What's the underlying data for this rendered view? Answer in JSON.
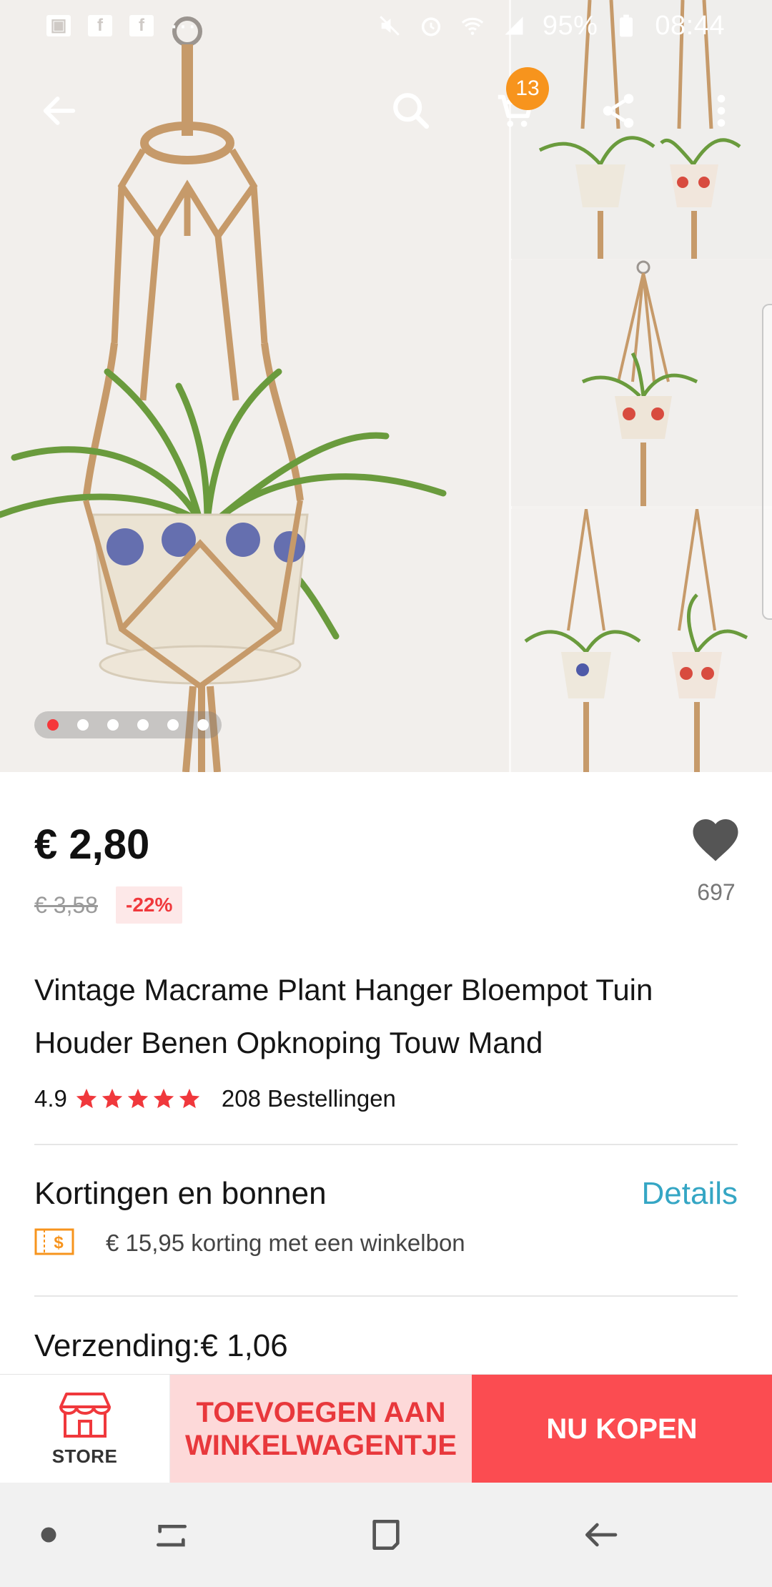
{
  "status_bar": {
    "battery": "95%",
    "time": "08:44"
  },
  "top_bar": {
    "cart_count": "13"
  },
  "gallery": {
    "image_count": 6,
    "active_index": 0
  },
  "product": {
    "price": "€ 2,80",
    "old_price": "€ 3,58",
    "discount": "-22%",
    "wishlist_count": "697",
    "title": "Vintage Macrame Plant Hanger Bloempot Tuin Houder Benen Opknoping Touw Mand",
    "rating": "4.9",
    "stars": 5,
    "orders": "208 Bestellingen"
  },
  "coupons": {
    "title": "Kortingen en bonnen",
    "details_link": "Details",
    "coupon_text": "€ 15,95 korting met een winkelbon"
  },
  "shipping": {
    "text": "Verzending:€ 1,06"
  },
  "action_bar": {
    "store_label": "STORE",
    "add_to_cart_line1": "TOEVOEGEN AAN",
    "add_to_cart_line2": "WINKELWAGENTJE",
    "buy_now_label": "NU KOPEN"
  },
  "colors": {
    "accent_red": "#fb4c51",
    "link_blue": "#35a6c4",
    "badge_orange": "#f7941d",
    "star_red": "#f0383c"
  }
}
